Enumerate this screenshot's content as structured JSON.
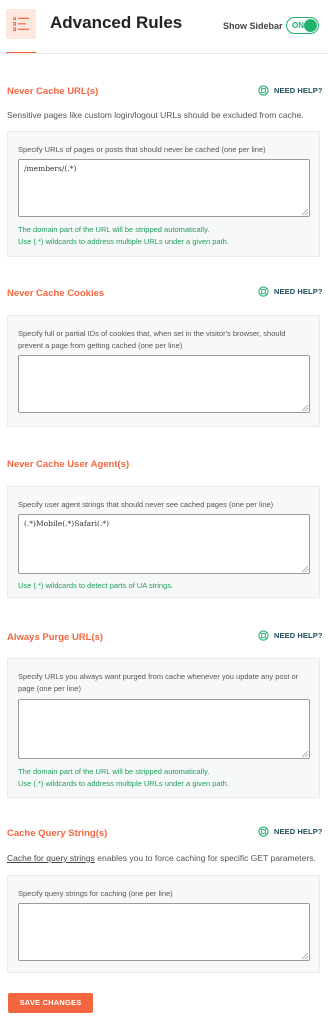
{
  "header": {
    "title": "Advanced Rules",
    "sidebar_label": "Show Sidebar",
    "toggle_label": "ON"
  },
  "help_label": "NEED HELP?",
  "sections": {
    "never_cache_urls": {
      "title": "Never Cache URL(s)",
      "description": "Sensitive pages like custom login/logout URLs should be excluded from cache.",
      "field_label": "Specify URLs of pages or posts that should never be cached (one per line)",
      "value": "/members/(.*)",
      "notes": [
        "The domain part of the URL will be stripped automatically.",
        "Use (.*) wildcards to address multiple URLs under a given path."
      ]
    },
    "never_cache_cookies": {
      "title": "Never Cache Cookies",
      "field_label": "Specify full or partial IDs of cookies that, when set in the visitor's browser, should prevent a page from getting cached (one per line)",
      "value": ""
    },
    "never_cache_user_agents": {
      "title": "Never Cache User Agent(s)",
      "field_label": "Specify user agent strings that should never see cached pages (one per line)",
      "value": "(.*)Mobile(.*)Safari(.*)",
      "notes": [
        "Use (.*) wildcards to detect parts of UA strings."
      ]
    },
    "always_purge_urls": {
      "title": "Always Purge URL(s)",
      "field_label": "Specify URLs you always want purged from cache whenever you update any post or page (one per line)",
      "value": "",
      "notes": [
        "The domain part of the URL will be stripped automatically.",
        "Use (.*) wildcards to address multiple URLs under a given path."
      ]
    },
    "cache_query_strings": {
      "title": "Cache Query String(s)",
      "description_link": "Cache for query strings",
      "description_rest": " enables you to force caching for specific GET parameters.",
      "field_label": "Specify query strings for caching (one per line)",
      "value": ""
    }
  },
  "save_button": "SAVE CHANGES",
  "colors": {
    "accent": "#f4663f",
    "success": "#23b26d",
    "help": "#1f4f5a"
  }
}
